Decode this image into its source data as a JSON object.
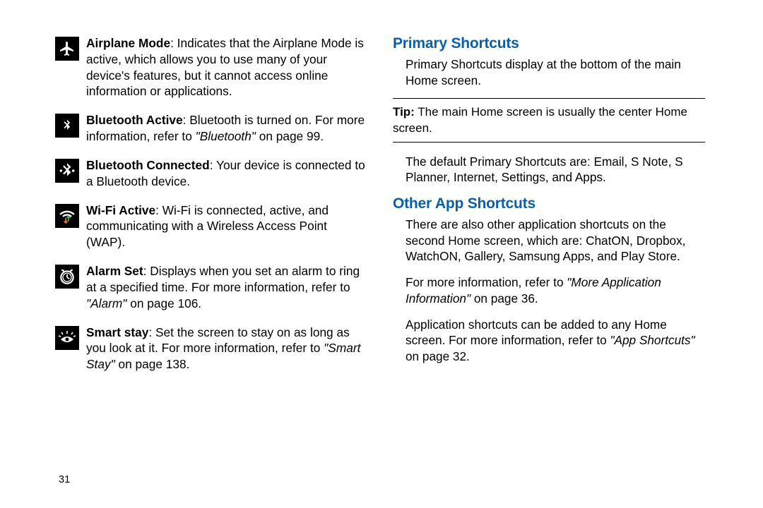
{
  "left": {
    "items": [
      {
        "icon": "airplane-icon",
        "bold": "Airplane Mode",
        "text": ": Indicates that the Airplane Mode is active, which allows you to use many of your device's features, but it cannot access online information or applications."
      },
      {
        "icon": "bluetooth-icon",
        "bold": "Bluetooth Active",
        "text_pre": ": Bluetooth is turned on. For more information, refer to ",
        "italic": "\"Bluetooth\"",
        "text_post": " on page 99."
      },
      {
        "icon": "bluetooth-connected-icon",
        "bold": "Bluetooth Connected",
        "text": ": Your device is connected to a Bluetooth device."
      },
      {
        "icon": "wifi-icon",
        "bold": "Wi-Fi Active",
        "text": ": Wi-Fi is connected, active, and communicating with a Wireless Access Point (WAP)."
      },
      {
        "icon": "alarm-icon",
        "bold": "Alarm Set",
        "text_pre": ": Displays when you set an alarm to ring at a specified time. For more information, refer to ",
        "italic": "\"Alarm\"",
        "text_post": " on page 106."
      },
      {
        "icon": "smart-stay-icon",
        "bold": "Smart stay",
        "text_pre": ": Set the screen to stay on as long as you look at it. For more information, refer to ",
        "italic": "\"Smart Stay\"",
        "text_post": " on page 138."
      }
    ]
  },
  "right": {
    "heading1": "Primary Shortcuts",
    "p1": "Primary Shortcuts display at the bottom of the main Home screen.",
    "tip_bold": "Tip:",
    "tip_text": " The main Home screen is usually the center Home screen.",
    "p2": "The default Primary Shortcuts are: Email, S Note, S Planner, Internet, Settings, and Apps.",
    "heading2": "Other App Shortcuts",
    "p3": "There are also other application shortcuts on the second Home screen, which are: ChatON, Dropbox, WatchON, Gallery, Samsung Apps, and Play Store.",
    "p4_pre": "For more information, refer to ",
    "p4_italic": "\"More Application Information\"",
    "p4_post": " on page 36.",
    "p5_pre": "Application shortcuts can be added to any Home screen. For more information, refer to ",
    "p5_italic": "\"App Shortcuts\"",
    "p5_post": " on page 32."
  },
  "page_number": "31"
}
